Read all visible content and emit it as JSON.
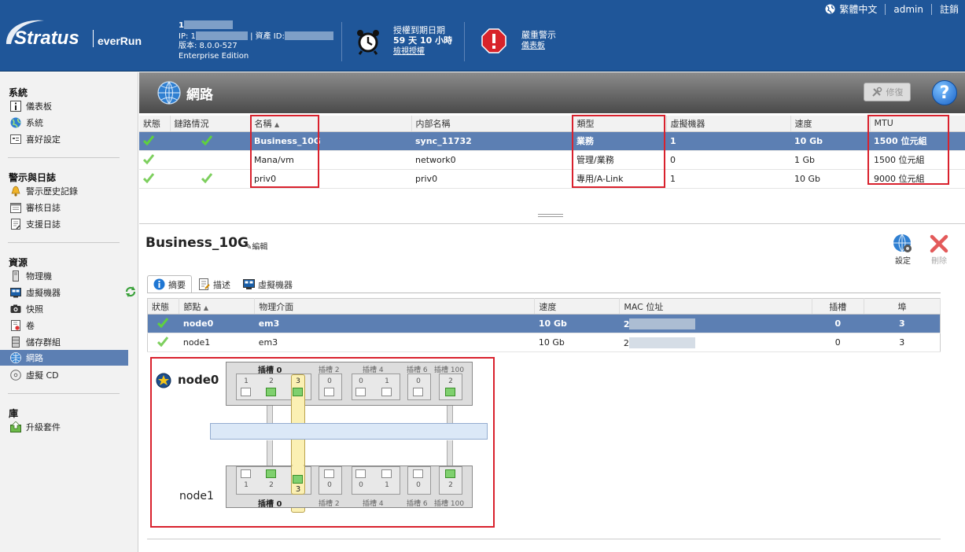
{
  "header": {
    "logo_brand": "Stratus",
    "logo_product": "everRun",
    "host_name": "1",
    "ip_label": "IP: 1",
    "asset_label": "資產 ID:",
    "version": "版本: 8.0.0-527",
    "edition": "Enterprise Edition",
    "license_line1": "授權到期日期",
    "license_line2": "59 天 10 小時",
    "license_link": "檢視授權",
    "alert_line1": "嚴重警示",
    "alert_link": "儀表板",
    "language": "繁體中文",
    "user": "admin",
    "logout": "註銷"
  },
  "sidebar": {
    "system_title": "系統",
    "system_items": [
      "儀表板",
      "系統",
      "喜好設定"
    ],
    "alerts_title": "警示與日誌",
    "alerts_items": [
      "警示歷史記錄",
      "審核日誌",
      "支援日誌"
    ],
    "resources_title": "資源",
    "resources_items": [
      "物理機",
      "虛擬機器",
      "快照",
      "卷",
      "儲存群組",
      "網路",
      "虛擬 CD"
    ],
    "library_title": "庫",
    "library_items": [
      "升級套件"
    ]
  },
  "page": {
    "title": "網路",
    "repair_label": "修復",
    "help_label": "?"
  },
  "network_table": {
    "headers": [
      "狀態",
      "鏈路情況",
      "名稱",
      "内部名稱",
      "類型",
      "虛擬機器",
      "速度",
      "MTU"
    ],
    "rows": [
      {
        "name": "Business_10G",
        "internal": "sync_11732",
        "type": "業務",
        "vms": "1",
        "speed": "10 Gb",
        "mtu": "1500 位元組"
      },
      {
        "name": "Mana/vm",
        "internal": "network0",
        "type": "管理/業務",
        "vms": "0",
        "speed": "1 Gb",
        "mtu": "1500 位元組"
      },
      {
        "name": "priv0",
        "internal": "priv0",
        "type": "專用/A-Link",
        "vms": "1",
        "speed": "10 Gb",
        "mtu": "9000 位元組"
      }
    ]
  },
  "detail": {
    "title": "Business_10G",
    "edit_label": "編輯",
    "settings_label": "設定",
    "delete_label": "刪除",
    "tabs": [
      "摘要",
      "描述",
      "虛擬機器"
    ],
    "node_headers": [
      "狀態",
      "節點",
      "物理介面",
      "速度",
      "MAC 位址",
      "插槽",
      "埠"
    ],
    "node_rows": [
      {
        "node": "node0",
        "iface": "em3",
        "speed": "10 Gb",
        "mac": "2",
        "slot": "0",
        "port": "3"
      },
      {
        "node": "node1",
        "iface": "em3",
        "speed": "10 Gb",
        "mac": "2",
        "slot": "0",
        "port": "3"
      }
    ]
  },
  "diagram": {
    "node0_label": "node0",
    "node1_label": "node1",
    "slot0_label": "插槽 0",
    "slot2_label": "插槽 2",
    "slot4_label": "插槽 4",
    "slot6_label": "插槽 6",
    "slot100_label": "插槽 100",
    "slot0_ports": [
      "1",
      "2",
      "3"
    ],
    "slot2_ports": [
      "0"
    ],
    "slot4_ports": [
      "0",
      "1"
    ],
    "slot6_ports": [
      "0"
    ],
    "slot100_ports": [
      "2"
    ]
  },
  "colors": {
    "header_bg": "#1f5699",
    "selected_row": "#5c7fb3",
    "highlight_red": "#d9212d"
  }
}
